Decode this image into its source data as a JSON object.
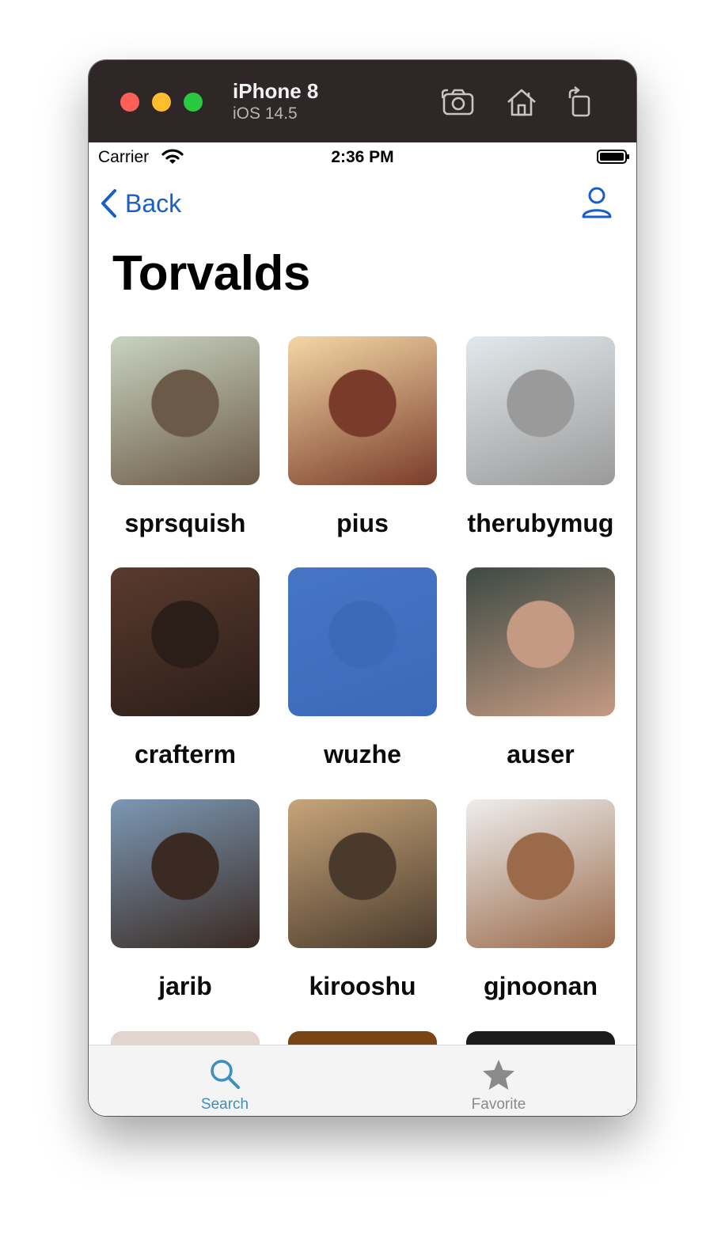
{
  "simulator": {
    "device_name": "iPhone 8",
    "os_version": "iOS 14.5",
    "icons": [
      "screenshot-icon",
      "home-icon",
      "rotate-icon"
    ]
  },
  "status_bar": {
    "carrier": "Carrier",
    "time": "2:36 PM"
  },
  "nav": {
    "back_label": "Back",
    "title": "Torvalds"
  },
  "users": [
    {
      "login": "sprsquish",
      "avatar_colors": [
        "#c9d3c1",
        "#6b5a47"
      ]
    },
    {
      "login": "pius",
      "avatar_colors": [
        "#f4d7a6",
        "#7a3c2a"
      ]
    },
    {
      "login": "therubymug",
      "avatar_colors": [
        "#e2e8ec",
        "#9a9a9a"
      ]
    },
    {
      "login": "crafterm",
      "avatar_colors": [
        "#5a3a2e",
        "#2b1e18"
      ]
    },
    {
      "login": "wuzhe",
      "avatar_colors": [
        "#4675c6",
        "#3c6ab9"
      ]
    },
    {
      "login": "auser",
      "avatar_colors": [
        "#3d4a44",
        "#c59a82"
      ]
    },
    {
      "login": "jarib",
      "avatar_colors": [
        "#7c98b5",
        "#3a2a22"
      ]
    },
    {
      "login": "kirooshu",
      "avatar_colors": [
        "#c7a57a",
        "#4a3a2c"
      ]
    },
    {
      "login": "gjnoonan",
      "avatar_colors": [
        "#eeeeee",
        "#9a6a4a"
      ]
    }
  ],
  "partial_row_colors": [
    "#e2d5d0",
    "#7a4514",
    "#1c1c1c"
  ],
  "tabs": [
    {
      "label": "Search",
      "icon": "search-icon",
      "active": true
    },
    {
      "label": "Favorite",
      "icon": "star-icon",
      "active": false
    }
  ],
  "colors": {
    "accent": "#1a5ec7",
    "tab_active": "#3c8fbf",
    "tab_inactive": "#8a8a8a",
    "titlebar": "#2f2627"
  }
}
